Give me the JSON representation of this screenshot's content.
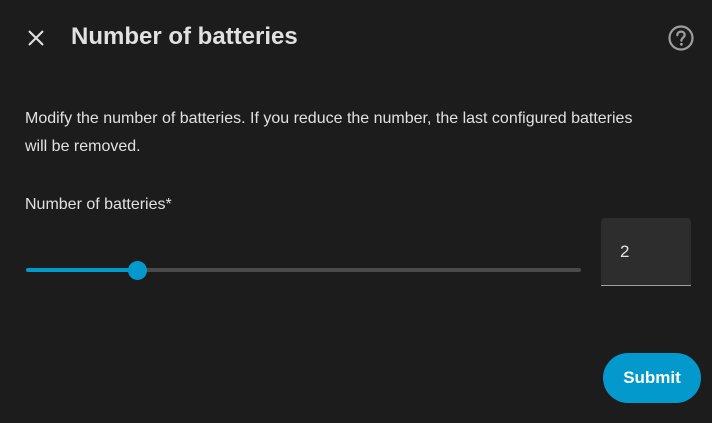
{
  "dialog": {
    "title": "Number of batteries",
    "close_icon": "close-icon",
    "help_icon": "help-circle-icon",
    "description": "Modify the number of batteries. If you reduce the number, the last configured batteries will be removed.",
    "field_label": "Number of batteries*",
    "slider": {
      "fraction": 0.2
    },
    "number_value": "2",
    "submit_label": "Submit"
  },
  "colors": {
    "background": "#1c1c1c",
    "accent": "#0399cc",
    "text": "#e1e1e1",
    "track": "#4a4a4a",
    "field_background": "#2d2d2d"
  }
}
